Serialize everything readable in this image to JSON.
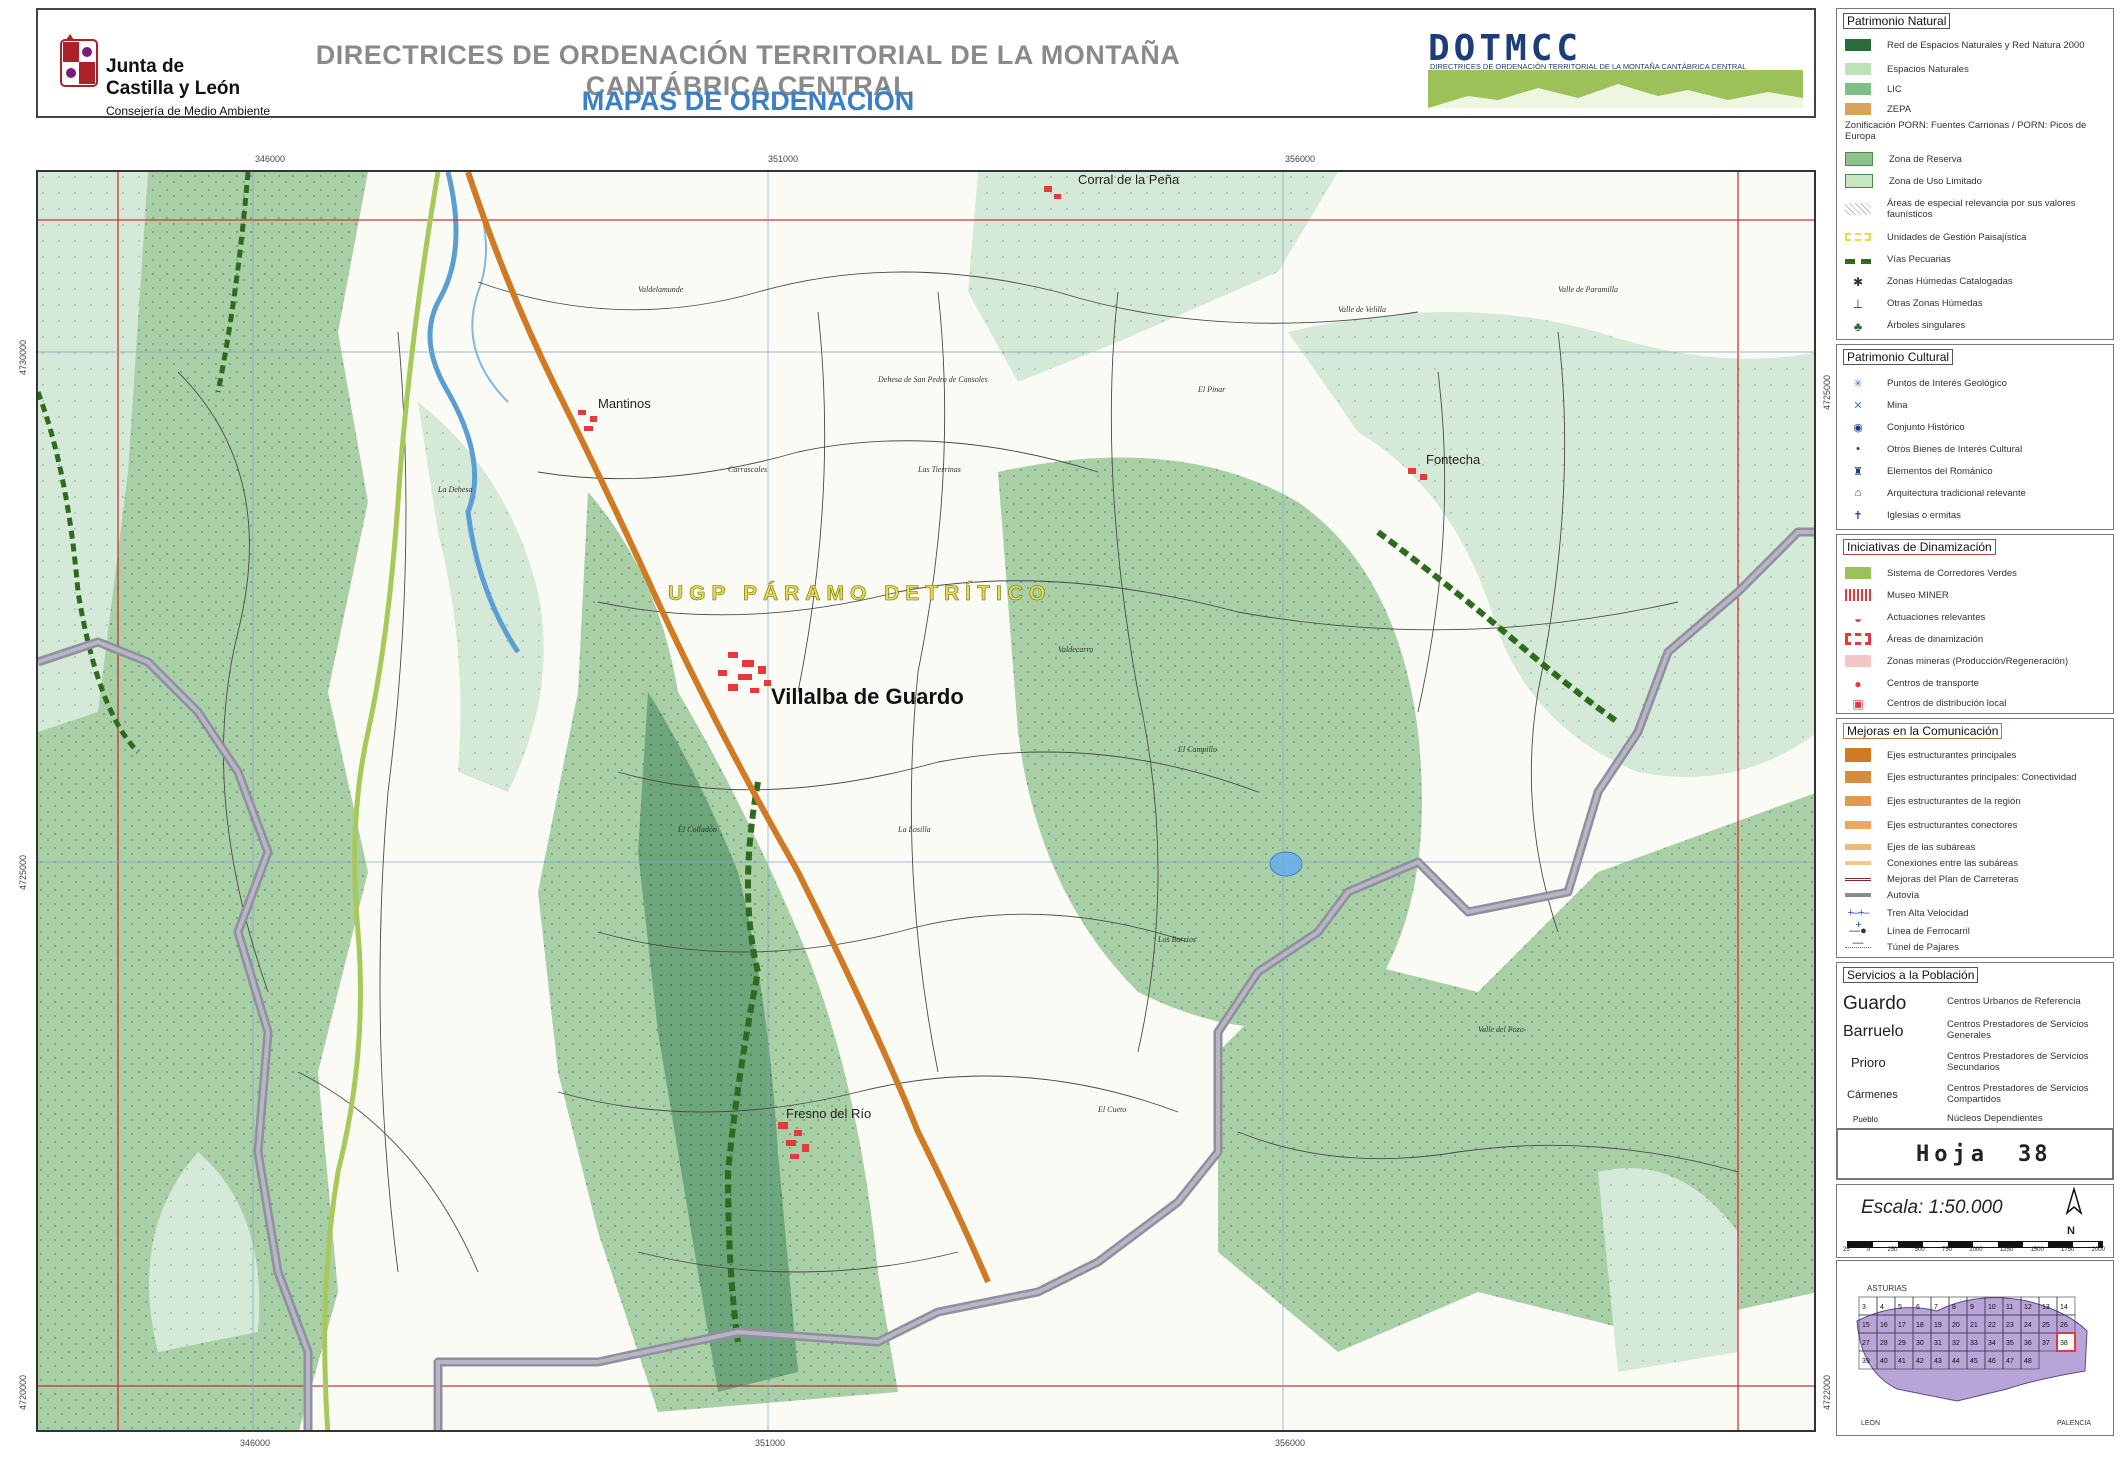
{
  "header": {
    "org_line1": "Junta de",
    "org_line2": "Castilla y León",
    "org_line3": "Consejería de Medio Ambiente",
    "title": "DIRECTRICES DE ORDENACIÓN TERRITORIAL DE LA MONTAÑA CANTÁBRICA CENTRAL",
    "subtitle": "MAPAS DE ORDENACIÓN",
    "brand": "DOTMCC",
    "brand_sub": "DIRECTRICES DE ORDENACIÓN TERRITORIAL DE LA MONTAÑA CANTÁBRICA CENTRAL"
  },
  "map": {
    "coords_top": [
      "346000",
      "351000",
      "356000"
    ],
    "coords_bottom": [
      "346000",
      "351000",
      "356000"
    ],
    "coords_left": [
      "4730000",
      "4725000",
      "4720000"
    ],
    "coords_right": [
      "4725000",
      "4722000"
    ],
    "places": {
      "villalba": "Villalba de Guardo",
      "mantinos": "Mantinos",
      "fresno": "Fresno del Río",
      "fontecha": "Fontecha",
      "corral": "Corral de la Peña"
    },
    "ugp_label": "UGP PÁRAMO DETRÍTICO",
    "toponyms": {
      "t1": "Valdelamunde",
      "t2": "Carrascales",
      "t3": "Las Tierrinas",
      "t4": "Valle de Velilla",
      "t5": "El Pinar",
      "t6": "El Campillo",
      "t7": "La Losilla",
      "t8": "Los Barrios",
      "t9": "El Colladón",
      "t10": "El Cueto",
      "t11": "Valdecarro",
      "t12": "La Dehesa",
      "t13": "Valle del Pozo",
      "t14": "Valle de Paramilla",
      "t15": "Dehesa de San Pedro de Cansoles"
    },
    "colors": {
      "forest": "#a9cfa6",
      "forest_dark": "#6ea67b",
      "scrub": "#dbece0",
      "border": "#8f8f9e",
      "road": "#d07a24",
      "grid": "#cc3333",
      "river": "#5a9fd4",
      "corridor": "#2f6b1e",
      "livestock": "#a8c85a",
      "urban": "#e23b3b"
    }
  },
  "legend": {
    "natural": {
      "title": "Patrimonio Natural",
      "items": [
        {
          "label": "Red de Espacios Naturales y Red Natura 2000",
          "icon": "network-icon",
          "color": "#2b6b3b"
        },
        {
          "label": "Espacios Naturales",
          "color": "#bfe1b8"
        },
        {
          "label": "LIC",
          "color": "#7fc08a"
        },
        {
          "label": "ZEPA",
          "color": "#d9a35a"
        },
        {
          "label": "Zonificación PORN: Fuentes Carrionas / PORN: Picos de Europa",
          "color": "#ffffff"
        },
        {
          "label": "Zona de Reserva",
          "color": "#8fc18c"
        },
        {
          "label": "Zona de Uso Limitado",
          "color": "#c9e6c3"
        },
        {
          "label": "Áreas de especial relevancia por sus valores faunísticos",
          "color": "#bbbbbb"
        },
        {
          "label": "Unidades de Gestión Paisajística",
          "color": "#e6dc4a"
        },
        {
          "label": "Vías Pecuarias",
          "color": "#2f6b1e"
        },
        {
          "label": "Zonas Húmedas Catalogadas",
          "icon": "wetland-icon",
          "color": "#333333"
        },
        {
          "label": "Otras Zonas Húmedas",
          "icon": "marsh-icon",
          "color": "#333333"
        },
        {
          "label": "Árboles singulares",
          "icon": "tree-icon",
          "color": "#2b6b3b"
        }
      ]
    },
    "cultural": {
      "title": "Patrimonio Cultural",
      "items": [
        {
          "label": "Puntos de Interés Geológico",
          "icon": "geology-icon",
          "color": "#3b7fc4"
        },
        {
          "label": "Mina",
          "icon": "mine-icon",
          "color": "#3b7fc4"
        },
        {
          "label": "Conjunto Histórico",
          "icon": "historic-icon",
          "color": "#1f3c7a"
        },
        {
          "label": "Otros Bienes de Interés Cultural",
          "icon": "bic-icon",
          "color": "#1f3c7a"
        },
        {
          "label": "Elementos del Románico",
          "icon": "romanesque-icon",
          "color": "#1f3c7a"
        },
        {
          "label": "Arquitectura tradicional relevante",
          "icon": "architecture-icon",
          "color": "#1f3c7a"
        },
        {
          "label": "Iglesias o ermitas",
          "icon": "church-icon",
          "color": "#1f3c7a"
        }
      ]
    },
    "dinamizacion": {
      "title": "Iniciativas de Dinamización",
      "items": [
        {
          "label": "Sistema de Corredores Verdes",
          "color": "#9bc158"
        },
        {
          "label": "Museo MINER",
          "color": "#e23b3b"
        },
        {
          "label": "Actuaciones relevantes",
          "icon": "action-icon",
          "color": "#e23b3b"
        },
        {
          "label": "Áreas de dinamización",
          "color": "#e23b3b"
        },
        {
          "label": "Zonas mineras (Producción/Regeneración)",
          "color": "#f3c7c7"
        },
        {
          "label": "Centros de transporte",
          "icon": "transport-icon",
          "color": "#e23b3b"
        },
        {
          "label": "Centros de distribución local",
          "icon": "distribution-icon",
          "color": "#e23b3b"
        }
      ]
    },
    "comunicacion": {
      "title": "Mejoras en la Comunicación",
      "items": [
        {
          "label": "Ejes estructurantes principales",
          "color": "#d07a24"
        },
        {
          "label": "Ejes estructurantes principales: Conectividad",
          "color": "#d98a3a"
        },
        {
          "label": "Ejes estructurantes de la región",
          "color": "#e09a50"
        },
        {
          "label": "Ejes estructurantes conectores",
          "color": "#e8a962"
        },
        {
          "label": "Ejes de las subáreas",
          "color": "#efba78"
        },
        {
          "label": "Conexiones entre las subáreas",
          "color": "#f3c78c"
        },
        {
          "label": "Mejoras del Plan de Carreteras",
          "color": "#7a2a2a"
        },
        {
          "label": "Autovía",
          "color": "#8a8a8a"
        },
        {
          "label": "Tren Alta Velocidad",
          "color": "#2b4fb0"
        },
        {
          "label": "Línea de Ferrocarril",
          "color": "#333333"
        },
        {
          "label": "Túnel de Pajares",
          "color": "#666666"
        }
      ]
    },
    "servicios": {
      "title": "Servicios a la Población",
      "items": [
        {
          "name": "Guardo",
          "desc": "Centros Urbanos de Referencia"
        },
        {
          "name": "Barruelo",
          "desc": "Centros Prestadores de Servicios Generales"
        },
        {
          "name": "Prioro",
          "desc": "Centros Prestadores de Servicios Secundarios"
        },
        {
          "name": "Cármenes",
          "desc": "Centros Prestadores de Servicios Compartidos"
        },
        {
          "name": "Pueblo",
          "desc": "Núcleos Dependientes"
        }
      ]
    },
    "sheet": {
      "label": "Hoja",
      "number": "38"
    },
    "scale": {
      "label": "Escala: 1:50.000",
      "north": "N",
      "ticks": [
        "25",
        "0",
        "250",
        "500",
        "750",
        "1000",
        "1250",
        "1500",
        "1750",
        "2000"
      ]
    },
    "index": {
      "sheets": [
        "3",
        "4",
        "5",
        "6",
        "7",
        "8",
        "9",
        "10",
        "11",
        "12",
        "13",
        "14",
        "15",
        "16",
        "17",
        "18",
        "19",
        "20",
        "21",
        "22",
        "23",
        "24",
        "25",
        "26",
        "27",
        "28",
        "29",
        "30",
        "31",
        "32",
        "33",
        "34",
        "35",
        "36",
        "37",
        "38",
        "39",
        "40",
        "41",
        "42",
        "43",
        "44",
        "45",
        "46",
        "47",
        "48"
      ],
      "current": "38",
      "label_top": "ASTURIAS",
      "label_bottom": "LEÓN",
      "label_right": "PALENCIA"
    }
  }
}
